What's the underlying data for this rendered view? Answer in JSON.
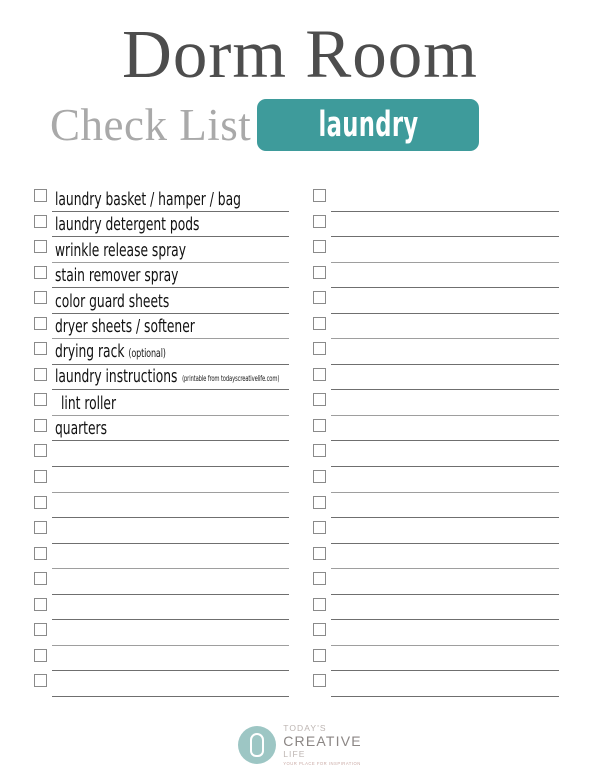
{
  "header": {
    "title_main": "Dorm Room",
    "title_sub": "Check List",
    "category": "laundry",
    "accent_color": "#3e9b9b",
    "title_color": "#4d4d4d",
    "subtitle_color": "#a9a9a9"
  },
  "checklist": {
    "total_rows_per_column": 20,
    "left_column": [
      {
        "label": "laundry basket / hamper / bag",
        "note": "",
        "note_size": "",
        "indent": false
      },
      {
        "label": "laundry detergent pods",
        "note": "",
        "note_size": "",
        "indent": false
      },
      {
        "label": "wrinkle release spray",
        "note": "",
        "note_size": "",
        "indent": false
      },
      {
        "label": "stain remover spray",
        "note": "",
        "note_size": "",
        "indent": false
      },
      {
        "label": "color guard sheets",
        "note": "",
        "note_size": "",
        "indent": false
      },
      {
        "label": "dryer sheets / softener",
        "note": "",
        "note_size": "",
        "indent": false
      },
      {
        "label": "drying rack",
        "note": "(optional)",
        "note_size": "small",
        "indent": false
      },
      {
        "label": "laundry instructions",
        "note": "(printable from todayscreativelife.com)",
        "note_size": "tiny",
        "indent": false
      },
      {
        "label": "lint roller",
        "note": "",
        "note_size": "",
        "indent": true
      },
      {
        "label": "quarters",
        "note": "",
        "note_size": "",
        "indent": false
      },
      {
        "label": "",
        "note": "",
        "note_size": "",
        "indent": false
      },
      {
        "label": "",
        "note": "",
        "note_size": "",
        "indent": false
      },
      {
        "label": "",
        "note": "",
        "note_size": "",
        "indent": false
      },
      {
        "label": "",
        "note": "",
        "note_size": "",
        "indent": false
      },
      {
        "label": "",
        "note": "",
        "note_size": "",
        "indent": false
      },
      {
        "label": "",
        "note": "",
        "note_size": "",
        "indent": false
      },
      {
        "label": "",
        "note": "",
        "note_size": "",
        "indent": false
      },
      {
        "label": "",
        "note": "",
        "note_size": "",
        "indent": false
      },
      {
        "label": "",
        "note": "",
        "note_size": "",
        "indent": false
      },
      {
        "label": "",
        "note": "",
        "note_size": "",
        "indent": false
      }
    ],
    "right_column": [
      {
        "label": "",
        "note": "",
        "note_size": "",
        "indent": false
      },
      {
        "label": "",
        "note": "",
        "note_size": "",
        "indent": false
      },
      {
        "label": "",
        "note": "",
        "note_size": "",
        "indent": false
      },
      {
        "label": "",
        "note": "",
        "note_size": "",
        "indent": false
      },
      {
        "label": "",
        "note": "",
        "note_size": "",
        "indent": false
      },
      {
        "label": "",
        "note": "",
        "note_size": "",
        "indent": false
      },
      {
        "label": "",
        "note": "",
        "note_size": "",
        "indent": false
      },
      {
        "label": "",
        "note": "",
        "note_size": "",
        "indent": false
      },
      {
        "label": "",
        "note": "",
        "note_size": "",
        "indent": false
      },
      {
        "label": "",
        "note": "",
        "note_size": "",
        "indent": false
      },
      {
        "label": "",
        "note": "",
        "note_size": "",
        "indent": false
      },
      {
        "label": "",
        "note": "",
        "note_size": "",
        "indent": false
      },
      {
        "label": "",
        "note": "",
        "note_size": "",
        "indent": false
      },
      {
        "label": "",
        "note": "",
        "note_size": "",
        "indent": false
      },
      {
        "label": "",
        "note": "",
        "note_size": "",
        "indent": false
      },
      {
        "label": "",
        "note": "",
        "note_size": "",
        "indent": false
      },
      {
        "label": "",
        "note": "",
        "note_size": "",
        "indent": false
      },
      {
        "label": "",
        "note": "",
        "note_size": "",
        "indent": false
      },
      {
        "label": "",
        "note": "",
        "note_size": "",
        "indent": false
      },
      {
        "label": "",
        "note": "",
        "note_size": "",
        "indent": false
      }
    ]
  },
  "footer": {
    "logo_line1": "TODAY'S",
    "logo_line2": "CREATIVE",
    "logo_line3": "LIFE",
    "logo_tagline": "YOUR PLACE FOR INSPIRATION",
    "logo_color": "#9dc6c4"
  }
}
